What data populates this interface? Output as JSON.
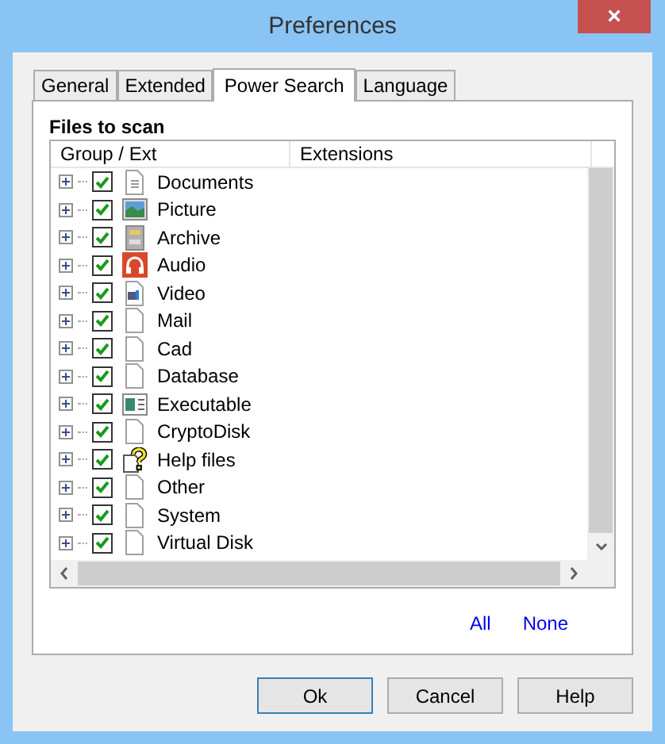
{
  "window": {
    "title": "Preferences",
    "close": "×"
  },
  "tabs": [
    {
      "label": "General",
      "selected": false
    },
    {
      "label": "Extended",
      "selected": false
    },
    {
      "label": "Power Search",
      "selected": true
    },
    {
      "label": "Language",
      "selected": false
    }
  ],
  "section_title": "Files to scan",
  "list": {
    "columns": [
      "Group / Ext",
      "Extensions"
    ],
    "rows": [
      {
        "label": "Documents",
        "kind": "document",
        "checked": true
      },
      {
        "label": "Picture",
        "kind": "picture",
        "checked": true
      },
      {
        "label": "Archive",
        "kind": "archive",
        "checked": true
      },
      {
        "label": "Audio",
        "kind": "audio",
        "checked": true
      },
      {
        "label": "Video",
        "kind": "video",
        "checked": true
      },
      {
        "label": "Mail",
        "kind": "file",
        "checked": true
      },
      {
        "label": "Cad",
        "kind": "file",
        "checked": true
      },
      {
        "label": "Database",
        "kind": "file",
        "checked": true
      },
      {
        "label": "Executable",
        "kind": "executable",
        "checked": true
      },
      {
        "label": "CryptoDisk",
        "kind": "file",
        "checked": true
      },
      {
        "label": "Help files",
        "kind": "help",
        "checked": true
      },
      {
        "label": "Other",
        "kind": "file",
        "checked": true
      },
      {
        "label": "System",
        "kind": "file",
        "checked": true
      },
      {
        "label": "Virtual Disk",
        "kind": "file",
        "checked": true
      }
    ]
  },
  "links": [
    "All",
    "None"
  ],
  "buttons": [
    {
      "label": "Ok",
      "selected": true
    },
    {
      "label": "Cancel",
      "selected": false
    },
    {
      "label": "Help",
      "selected": false
    }
  ]
}
